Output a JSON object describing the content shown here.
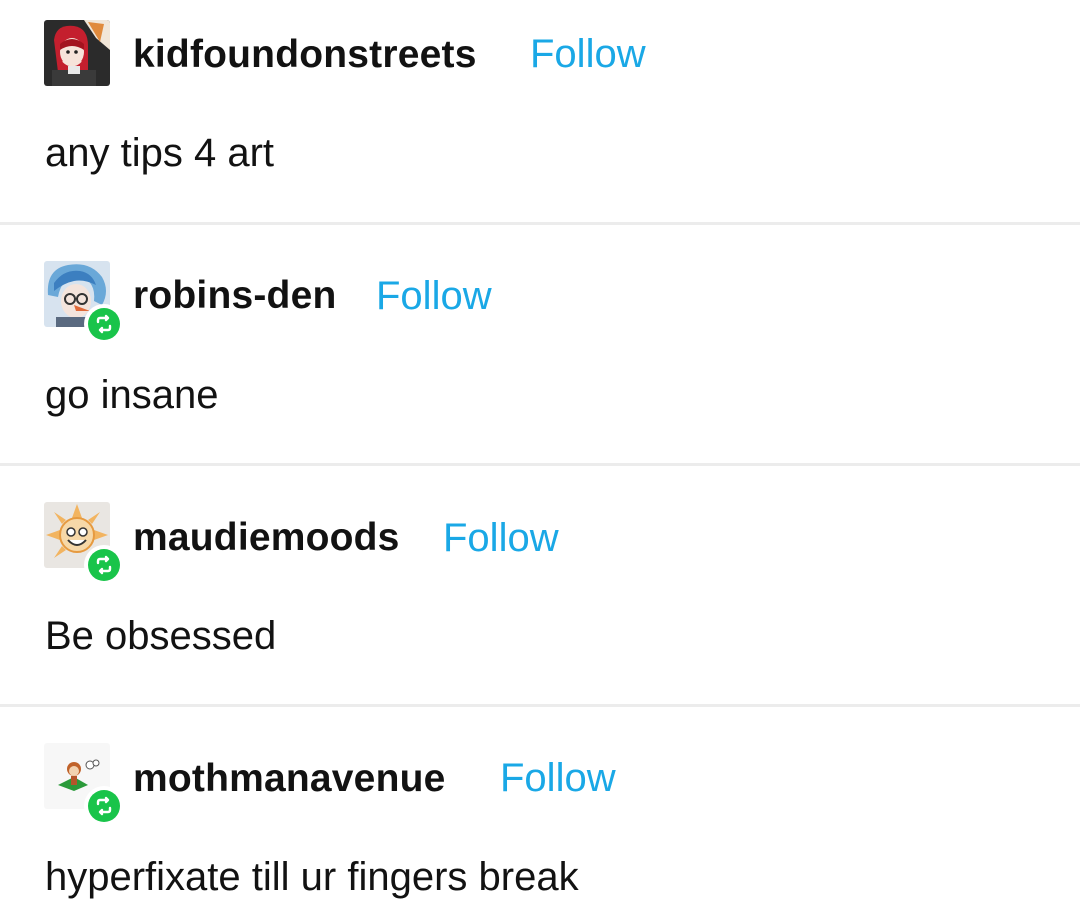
{
  "posts": [
    {
      "username": "kidfoundonstreets",
      "follow_label": "Follow",
      "text": "any tips 4 art",
      "avatar_icon": "avatar-red-hair-fox",
      "reblogged": false
    },
    {
      "username": "robins-den",
      "follow_label": "Follow",
      "text": "go insane",
      "avatar_icon": "avatar-blue-hair",
      "reblogged": true
    },
    {
      "username": "maudiemoods",
      "follow_label": "Follow",
      "text": "Be obsessed",
      "avatar_icon": "avatar-sun-face",
      "reblogged": true
    },
    {
      "username": "mothmanavenue",
      "follow_label": "Follow",
      "text": "hyperfixate till ur fingers break",
      "avatar_icon": "avatar-small-character",
      "reblogged": true
    }
  ],
  "colors": {
    "follow": "#1aa8e6",
    "reblog_badge": "#19c44a",
    "divider": "#ececec",
    "text": "#121212"
  }
}
